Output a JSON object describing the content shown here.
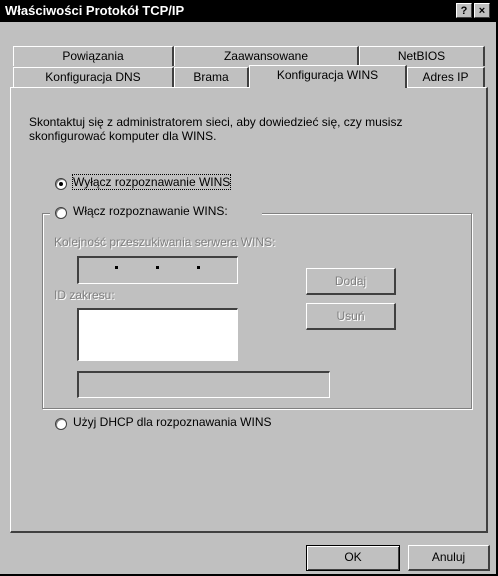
{
  "window": {
    "title": "Właściwości Protokół TCP/IP",
    "help_glyph": "?",
    "close_glyph": "×"
  },
  "tabs_back": [
    "Powiązania",
    "Zaawansowane",
    "NetBIOS"
  ],
  "tabs_front": [
    "Konfiguracja DNS",
    "Brama",
    "Konfiguracja WINS",
    "Adres IP"
  ],
  "active_tab": "Konfiguracja WINS",
  "info_text": [
    "Skontaktuj się z administratorem sieci, aby dowiedzieć się, czy musisz",
    "skonfigurować komputer dla WINS."
  ],
  "options": {
    "disable_wins": "Wyłącz rozpoznawanie WINS",
    "enable_wins": "Włącz rozpoznawanie WINS:",
    "use_dhcp": "Użyj DHCP dla rozpoznawania WINS",
    "selected": "disable_wins"
  },
  "wins_group": {
    "search_order_label": "Kolejność przeszukiwania serwera WINS:",
    "add_button": "Dodaj",
    "remove_button": "Usuń",
    "scope_id_label": "ID zakresu:"
  },
  "footer": {
    "ok_button": "OK",
    "cancel_button": "Anuluj"
  }
}
